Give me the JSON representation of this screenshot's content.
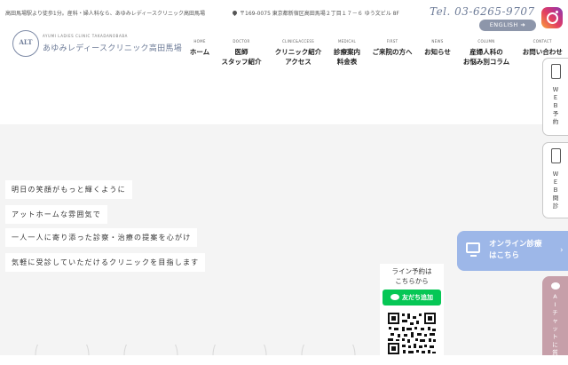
{
  "topbar": {
    "intro": "高田馬場駅より徒歩1分。産科・婦人科なら、あゆみレディースクリニック高田馬場",
    "address": "〒169-0075 東京都新宿区高田馬場２丁目１７－６ ゆう文ビル 8F",
    "address_icon": "map-pin-icon",
    "tel": "Tel. 03-6265-9707",
    "instagram_icon": "instagram-icon"
  },
  "english_button": "ENGLISH ➜",
  "logo": {
    "mark_text": "ALT",
    "en_name": "AYUMI LADIES CLINIC TAKADANOBABA",
    "jp_name": "あゆみレディースクリニック高田馬場"
  },
  "nav": [
    {
      "en": "HOME",
      "jp": "ホーム"
    },
    {
      "en": "DOCTOR",
      "jp": "医師\nスタッフ紹介"
    },
    {
      "en": "CLINIC&ACCESS",
      "jp": "クリニック紹介\nアクセス"
    },
    {
      "en": "MEDICAL",
      "jp": "診療案内\n料金表"
    },
    {
      "en": "FIRST",
      "jp": "ご来院の方へ"
    },
    {
      "en": "NEWS",
      "jp": "お知らせ"
    },
    {
      "en": "COLUMN",
      "jp": "産婦人科の\nお悩み別コラム"
    },
    {
      "en": "CONTACT",
      "jp": "お問い合わせ"
    }
  ],
  "taglines": [
    "明日の笑顔がもっと輝くように",
    "アットホームな雰囲気で",
    "一人一人に寄り添った診察・治療の提案を心がけ",
    "気軽に受診していただけるクリニックを目指します"
  ],
  "side_tabs": {
    "web_reserve": "ＷＥＢ予約",
    "web_inquiry": "ＷＥＢ問診",
    "phone_icon": "smartphone-icon"
  },
  "online_banner": {
    "label": "オンライン診療\nはこちら",
    "icon": "monitor-icon",
    "arrow": "›"
  },
  "ai_chat": {
    "label": "AIチャットに質問",
    "icon": "chat-bubble-icon"
  },
  "line": {
    "title": "ライン予約は\nこちらから",
    "button": "友だち追加",
    "icon": "line-icon",
    "qr": "qr-code-icon"
  },
  "colors": {
    "brand": "#6e7c98",
    "hero_bg": "#f4f4f4",
    "online_banner": "#9db7e8",
    "ai_tab": "#c69fa9",
    "line_green": "#06c755"
  }
}
